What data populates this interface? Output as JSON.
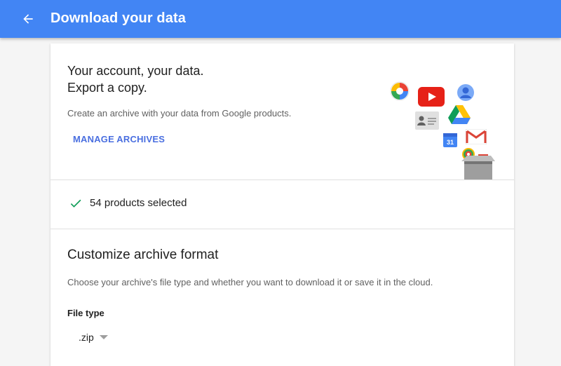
{
  "header": {
    "title": "Download your data",
    "back_icon": "arrow-back-icon"
  },
  "hero": {
    "title_line1": "Your account, your data.",
    "title_line2": "Export a copy.",
    "description": "Create an archive with your data from Google products.",
    "manage_link": "MANAGE ARCHIVES",
    "illustration_icons": [
      "photos-icon",
      "youtube-icon",
      "account-icon",
      "contacts-icon",
      "drive-icon",
      "calendar-icon",
      "gmail-icon",
      "hangouts-icon",
      "box-icon"
    ]
  },
  "products": {
    "selected_text": "54 products selected",
    "check_icon": "check-icon"
  },
  "customize": {
    "title": "Customize archive format",
    "description": "Choose your archive's file type and whether you want to download it or save it in the cloud.",
    "file_type_label": "File type",
    "file_type_value": ".zip"
  },
  "colors": {
    "header_bg": "#4285f4",
    "link": "#4a6fe0",
    "check": "#0f9d58"
  }
}
